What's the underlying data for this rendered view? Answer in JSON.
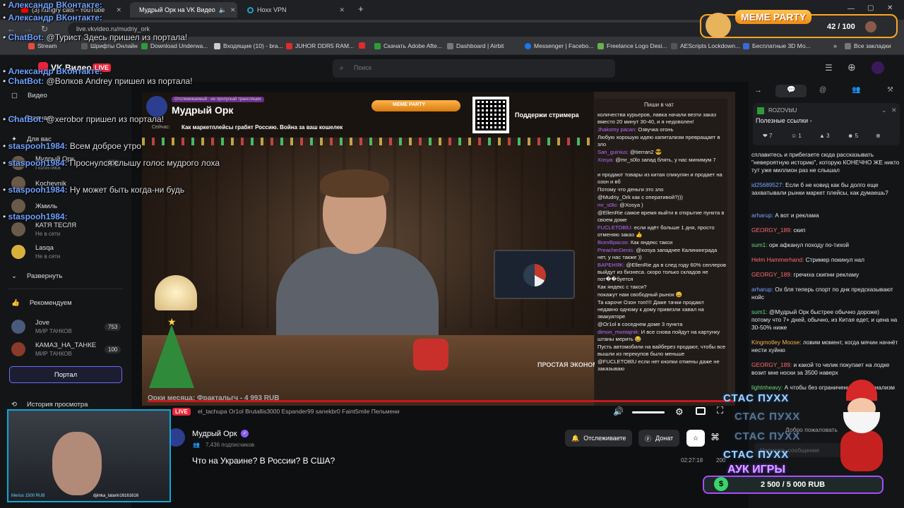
{
  "tabs": [
    {
      "label": "(3) hungry cats - YouTube"
    },
    {
      "label": "Мудрый Орк на VK Видео"
    },
    {
      "label": "Hoxx VPN"
    }
  ],
  "address": {
    "url": "live.vkvideo.ru/mudriy_ork"
  },
  "bookmarks": [
    {
      "label": "Stream",
      "color": "#e74c3c"
    },
    {
      "label": "Шрифты Онлайн",
      "color": "#5b5b5b"
    },
    {
      "label": "Download Underwa...",
      "color": "#2e9c3a"
    },
    {
      "label": "Входящие (10) - bra...",
      "color": "#cccccc"
    },
    {
      "label": "JUHOR DDR5 RAM...",
      "color": "#e02b2b"
    },
    {
      "label": "",
      "color": "#e02b2b"
    },
    {
      "label": "Скачать Adobe Afte...",
      "color": "#2e9c3a"
    },
    {
      "label": "Dashboard | Airbit",
      "color": "#777777"
    },
    {
      "label": "Messenger | Facebo...",
      "color": "#1877f2"
    },
    {
      "label": "Freelance Logo Desi...",
      "color": "#6ab04c"
    },
    {
      "label": "AEScripts Lockdown...",
      "color": "#555555"
    },
    {
      "label": "Бесплатные 3D Мо...",
      "color": "#3a6ad6"
    },
    {
      "label": "Все закладки",
      "color": "#777777"
    }
  ],
  "header": {
    "logo": "VK Видео",
    "live": "LIVE",
    "search_placeholder": "Поиск"
  },
  "sidebar": {
    "video": "Видео",
    "main": "Главная",
    "for_you": "Для вас",
    "subs": [
      {
        "name": "Мудрый Орк",
        "sub": "Политика",
        "count": "200"
      },
      {
        "name": "Kochevnik",
        "sub": "",
        "count": ""
      },
      {
        "name": "Жмиль",
        "sub": "",
        "count": ""
      },
      {
        "name": "КАТЯ ТЕСЛЯ",
        "sub": "Не в сети",
        "count": ""
      },
      {
        "name": "Lasqa",
        "sub": "Не в сети",
        "count": ""
      }
    ],
    "expand": "Развернуть",
    "recommend": "Рекомендуем",
    "rec": [
      {
        "name": "Jove",
        "sub": "МИР ТАНКОВ",
        "count": "753"
      },
      {
        "name": "КАМАЗ_НА_ТАНКЕ",
        "sub": "МИР ТАНКОВ",
        "count": "100"
      }
    ],
    "portal": "Портал",
    "history": "История просмотра"
  },
  "stream": {
    "tag": "Отслеживаемый · не пропускай трансляции",
    "streamer": "Мудрый Орк",
    "caption_prefix": "Сейчас:",
    "caption": "Как маркетплейсы грабят Россию. Война за ваш кошелек",
    "meme_mini": "MEME PARTY",
    "support": "Поддержи стримера",
    "book_label": "ПРОСТАЯ ЭКОНОМИКА",
    "inchat_title": "Пиши в чат",
    "inchat": [
      {
        "nick": "",
        "text": "количества курьеров, лавка начали везти заказ вместо 20 минут 30-40, и я недоволен!"
      },
      {
        "nick": "Jhakomy pacan:",
        "text": "Озвучка огонь"
      },
      {
        "nick": "",
        "text": "Любую хорошую идею капитализм превращает в зло"
      },
      {
        "nick": "San_guinius:",
        "text": "@tierran2 😎"
      },
      {
        "nick": "Xosya:",
        "text": "@mr_s0lo запад блять, у нас минимум 7"
      },
      {
        "nick": "",
        "text": "и продают товары из китая спикулян и продает на озон и вб"
      },
      {
        "nick": "",
        "text": "Потому что деньги это зло"
      },
      {
        "nick": "",
        "text": "@Mudriy_Ork как с оперативой?)))"
      },
      {
        "nick": "mr_s0lo:",
        "text": "@Xosya )"
      },
      {
        "nick": "",
        "text": "@EllenRie самое время выйти в открытие пункта в своем доме"
      },
      {
        "nick": "FUCLETOBlU:",
        "text": "если идёт больше 1 дня, просто отменяю заказ 👍"
      },
      {
        "nick": "BcexBpacoo:",
        "text": "Как яндекс такси"
      },
      {
        "nick": "PreacherDenis:",
        "text": "@xosya западнее Калининграда нет, у нас также ))"
      },
      {
        "nick": "BAPEНЯK:",
        "text": "@EllenRie да в след году 60% селлеров выйдут из бизнеса. скоро только складов не пот��буется"
      },
      {
        "nick": "",
        "text": "Как яндекс с такси?"
      },
      {
        "nick": "",
        "text": "покажут нам свободный рынок 😄"
      },
      {
        "nick": "",
        "text": "Та карочe Озон топ!!!! Даже тачки продают недавно одному к дому привезли хавал на эвакуаторе"
      },
      {
        "nick": "",
        "text": "@Or1ol в соседнем доме 3 пункта"
      },
      {
        "nick": "dimon_montajnik:",
        "text": "И все снова пойдут на картунку штаны мерить 😂"
      },
      {
        "nick": "",
        "text": "Пусть автомобили на вайберез продают, чтобы все вышли из перекупов было меньше"
      },
      {
        "nick": "",
        "text": "@FUCLETOBlU если нет кнопки отмены даже не заказываю"
      }
    ],
    "donor_row": "Орки месяца:    Фрактальгч - 4 993 RUB",
    "live": "LIVE",
    "names_row": "el_tachupa      Or1ol      Brutallis3000      Espander99      sanekbr0      Faint5mile      Пельмени"
  },
  "under": {
    "channel": "Мудрый Орк",
    "subscribers": "7,436 подписчиков",
    "title": "Что на Украине? В России? В США?",
    "follow": "Отслеживаете",
    "donate": "Донат",
    "duration": "02:27:18",
    "duration_count": "200"
  },
  "right": {
    "pinned_name": "ROZOVblU",
    "pinned_text": "Полезные ссылки -",
    "reactions": [
      "7",
      "1",
      "3",
      "5"
    ],
    "chat": [
      {
        "nick": "",
        "nick_class": "",
        "text": "сплавитесь и прибегаете сюда рассказывать \"невероятную историю\", которую КОНЕЧНО ЖЕ никто тут уже миллион раз не слышал"
      },
      {
        "nick": "id25689527:",
        "nick_class": "nick-blue",
        "text": "Если б не ковид как бы долго еще захватывали рынки маркет плейсы, как думаешь?"
      },
      {
        "nick": "arharup:",
        "nick_class": "nick-blue",
        "text": "А вот и реклама"
      },
      {
        "nick": "GEORGY_189:",
        "nick_class": "nick-red",
        "text": "скип"
      },
      {
        "nick": "sum1:",
        "nick_class": "nick-green",
        "text": "орк афканул походу по-тихой"
      },
      {
        "nick": "Helm Hammerhand:",
        "nick_class": "nick-red",
        "text": "Стример покинул нал"
      },
      {
        "nick": "GEORGY_189:",
        "nick_class": "nick-red",
        "text": "гречиха скипни рекламу"
      },
      {
        "nick": "arharup:",
        "nick_class": "nick-blue",
        "text": "Ох бля теперь спорт по днк предсказывают нойс"
      },
      {
        "nick": "sum1:",
        "nick_class": "nick-green",
        "text": "@Мудрый Орк быстрее обычно дороже) потому что 7+ дней, обычно, из Китая едет, и цена на 30-50% ниже"
      },
      {
        "nick": "Kingmotley Moose:",
        "nick_class": "nick-orange",
        "text": "ловим момент, когда мячин начнёт нести хуйню"
      },
      {
        "nick": "GEORGY_189:",
        "nick_class": "nick-red",
        "text": "и какой то челик покупает на лодке возит мне носки за 3500 наверх"
      },
      {
        "nick": "lightnheavy:",
        "nick_class": "nick-green",
        "text": "А чтобы без ограничений это социализм"
      }
    ],
    "greeting": "Добро пожаловать",
    "write": "Написать сообщение"
  },
  "overlay": {
    "lines": [
      {
        "nick": "Александр ВКонтакте:",
        "text": ""
      },
      {
        "nick": "Александр ВКонтакте:",
        "text": ""
      },
      {
        "nick": "ChatBot:",
        "text": "@Турист Здесь пришел из портала!"
      },
      {
        "nick": "Александр ВКонтакте:",
        "text": ""
      },
      {
        "nick": "ChatBot:",
        "text": "@Волков Andrey пришел из портала!"
      },
      {
        "nick": "ChatBot:",
        "text": "@xerobor пришел из портала!"
      },
      {
        "nick": "staspooh1984:",
        "text": "Всем доброе утро"
      },
      {
        "nick": "staspooh1984:",
        "text": "Проснулся слышу голос мудрого лоха"
      },
      {
        "nick": "staspooh1984:",
        "text": "Ну может быть когда-ни будь"
      },
      {
        "nick": "staspooh1984:",
        "text": ""
      }
    ],
    "meme_title": "MEME PARTY",
    "meme_value": "42 / 100",
    "auk_title": "АУК ИГРЫ",
    "auk_value": "2 500 / 5 000 RUB",
    "stas": "СТАС ПУХХ",
    "webcam_label_left": "Merius 1500 RUB",
    "webcam_label_right": "djimka_tatarin16161616"
  }
}
